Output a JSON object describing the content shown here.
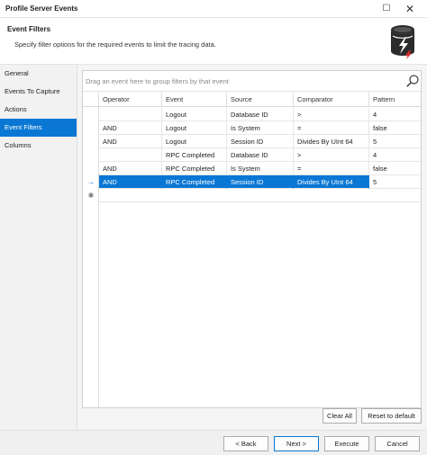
{
  "window": {
    "title": "Profile Server Events",
    "maximize_glyph": "☐",
    "close_glyph": "✕"
  },
  "header": {
    "title": "Event Filters",
    "subtitle": "Specify filter options for the required events to limit the tracing data.",
    "icon": "database-lightning-icon"
  },
  "sidebar": {
    "items": [
      {
        "label": "General",
        "active": false
      },
      {
        "label": "Events To Capture",
        "active": false
      },
      {
        "label": "Actions",
        "active": false
      },
      {
        "label": "Event Filters",
        "active": true
      },
      {
        "label": "Columns",
        "active": false
      }
    ]
  },
  "grid": {
    "group_panel_text": "Drag an event here to group filters by that event",
    "search_icon": "search-icon",
    "columns": [
      "Operator",
      "Event",
      "Source",
      "Comparator",
      "Pattern"
    ],
    "rows": [
      {
        "operator": "",
        "event": "Logout",
        "source": "Database ID",
        "comparator": ">",
        "pattern": "4",
        "selected": false
      },
      {
        "operator": "AND",
        "event": "Logout",
        "source": "Is System",
        "comparator": "=",
        "pattern": "false",
        "selected": false
      },
      {
        "operator": "AND",
        "event": "Logout",
        "source": "Session ID",
        "comparator": "Divides By UInt 64",
        "pattern": "5",
        "selected": false
      },
      {
        "operator": "",
        "event": "RPC Completed",
        "source": "Database ID",
        "comparator": ">",
        "pattern": "4",
        "selected": false
      },
      {
        "operator": "AND",
        "event": "RPC Completed",
        "source": "Is System",
        "comparator": "=",
        "pattern": "false",
        "selected": false
      },
      {
        "operator": "AND",
        "event": "RPC Completed",
        "source": "Session ID",
        "comparator": "Divides By UInt 64",
        "pattern": "5",
        "selected": true
      }
    ],
    "current_row_glyph": "→",
    "new_row_glyph": "✱"
  },
  "actions": {
    "clear_all": "Clear All",
    "reset_to_default": "Reset to default"
  },
  "footer": {
    "back": "< Back",
    "next": "Next >",
    "execute": "Execute",
    "cancel": "Cancel"
  },
  "colors": {
    "accent": "#0a77d5",
    "icon_dark": "#2b2b2b",
    "icon_red": "#d62b2b"
  }
}
